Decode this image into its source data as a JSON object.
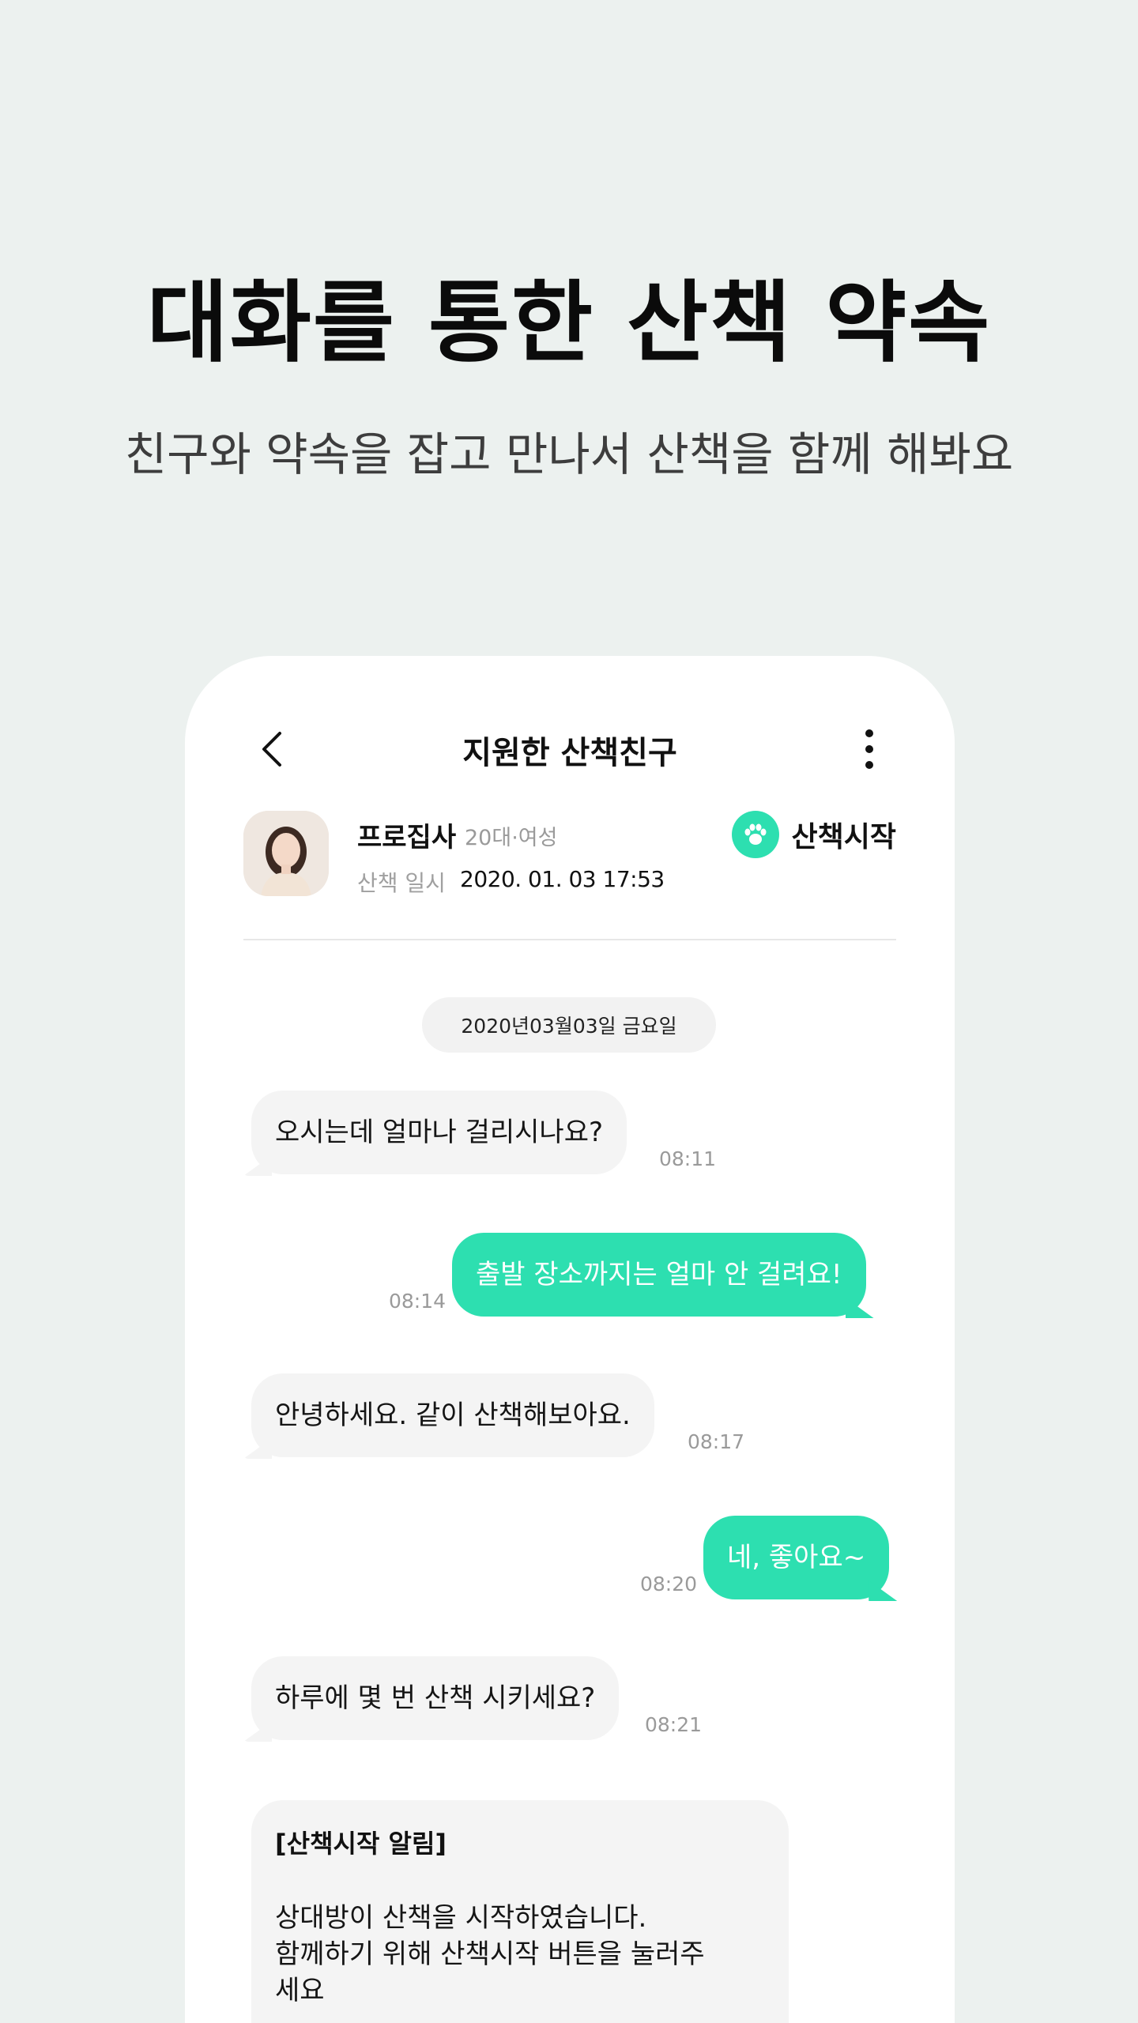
{
  "headline": "대화를 통한 산책 약속",
  "subline": "친구와 약속을 잡고 만나서 산책을 함께 해봐요",
  "header": {
    "title": "지원한 산책친구",
    "back_icon": "chevron-left-icon",
    "more_icon": "more-vertical-icon"
  },
  "profile": {
    "name": "프로집사",
    "meta": "20대·여성",
    "date_label": "산책 일시",
    "date_value": "2020. 01. 03 17:53",
    "walk_start_label": "산책시작",
    "walk_start_icon": "paw-icon"
  },
  "chat": {
    "date_chip": "2020년03월03일 금요일",
    "messages": [
      {
        "direction": "in",
        "text": "오시는데 얼마나 걸리시나요?",
        "time": "08:11"
      },
      {
        "direction": "out",
        "text": "출발 장소까지는 얼마 안 걸려요!",
        "time": "08:14"
      },
      {
        "direction": "in",
        "text": "안녕하세요. 같이 산책해보아요.",
        "time": "08:17"
      },
      {
        "direction": "out",
        "text": "네, 좋아요~",
        "time": "08:20"
      },
      {
        "direction": "in",
        "text": "하루에 몇 번 산책 시키세요?",
        "time": "08:21"
      }
    ],
    "notice": {
      "title": "[산책시작 알림]",
      "body": "상대방이 산책을 시작하였습니다.\n함께하기 위해 산책시작 버튼을 눌러주\n세요"
    }
  },
  "colors": {
    "background": "#ecf1ef",
    "accent": "#2ddfb0",
    "incoming_bubble": "#f4f4f4"
  }
}
